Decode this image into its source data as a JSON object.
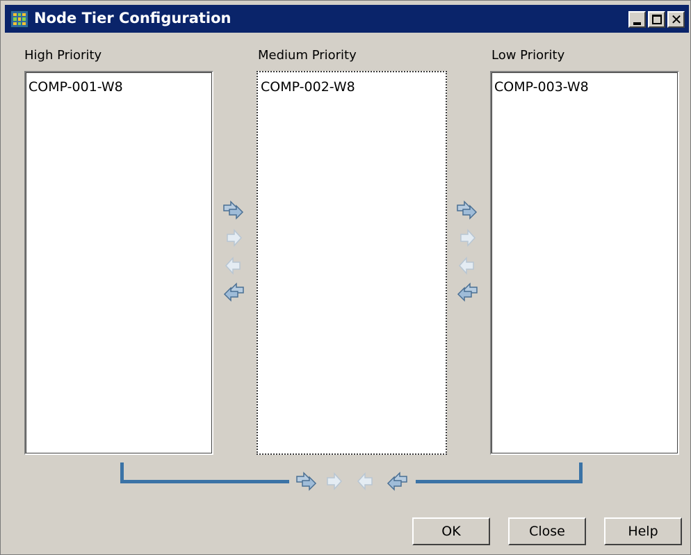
{
  "window": {
    "title": "Node Tier Configuration",
    "controls": {
      "minimize_icon": "minimize-icon",
      "maximize_icon": "maximize-icon",
      "close_label": "✕"
    }
  },
  "columns": {
    "high": {
      "label": "High Priority",
      "items": [
        "COMP-001-W8"
      ]
    },
    "medium": {
      "label": "Medium Priority",
      "items": [
        "COMP-002-W8"
      ]
    },
    "low": {
      "label": "Low Priority",
      "items": [
        "COMP-003-W8"
      ]
    }
  },
  "move_buttons": [
    "move-all-right-icon",
    "move-right-icon",
    "move-left-icon",
    "move-all-left-icon"
  ],
  "buttons": {
    "ok": "OK",
    "close": "Close",
    "help": "Help"
  },
  "colors": {
    "titlebar": "#0a246a",
    "dialog_bg": "#d4d0c8",
    "bracket": "#3b73a6",
    "arrow_fill": "#9fbcd8"
  }
}
